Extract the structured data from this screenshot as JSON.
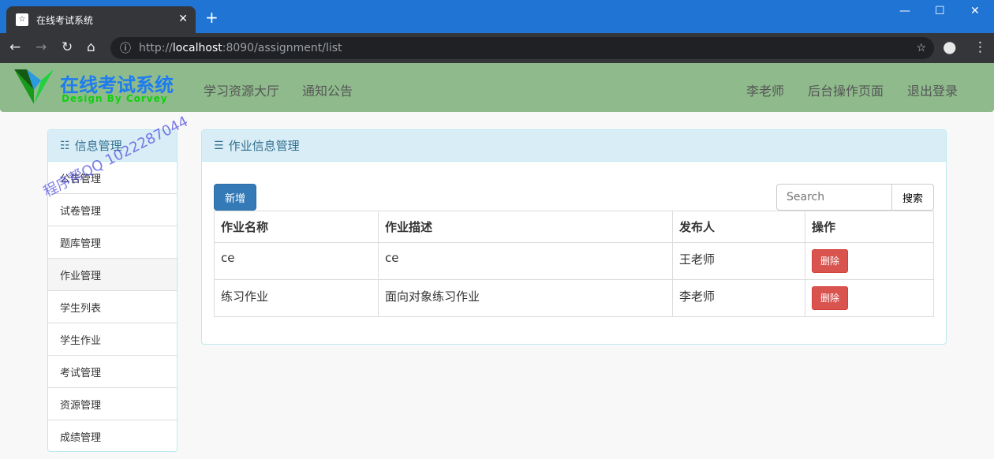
{
  "browser": {
    "tab_title": "在线考试系统",
    "url_prefix": "http://",
    "url_host": "localhost",
    "url_rest": ":8090/assignment/list"
  },
  "navbar": {
    "brand": "在线考试系统",
    "brand_sub": "Design By Corvey",
    "links": [
      "学习资源大厅",
      "通知公告"
    ],
    "right_links": [
      "李老师",
      "后台操作页面",
      "退出登录"
    ]
  },
  "watermark": "程序帮QQ 1022287044",
  "sidebar": {
    "title": "信息管理",
    "items": [
      "公告管理",
      "试卷管理",
      "题库管理",
      "作业管理",
      "学生列表",
      "学生作业",
      "考试管理",
      "资源管理",
      "成绩管理"
    ],
    "active": "作业管理"
  },
  "main": {
    "title": "作业信息管理",
    "add_label": "新增",
    "search_placeholder": "Search",
    "search_label": "搜索",
    "columns": [
      "作业名称",
      "作业描述",
      "发布人",
      "操作"
    ],
    "rows": [
      {
        "name": "ce",
        "desc": "ce",
        "publisher": "王老师",
        "action": "删除"
      },
      {
        "name": "练习作业",
        "desc": "面向对象练习作业",
        "publisher": "李老师",
        "action": "删除"
      }
    ]
  },
  "colors": {
    "navbar": "#8fbb8c",
    "primary": "#337ab7",
    "danger": "#d9534f",
    "panel_heading": "#d9edf7"
  }
}
